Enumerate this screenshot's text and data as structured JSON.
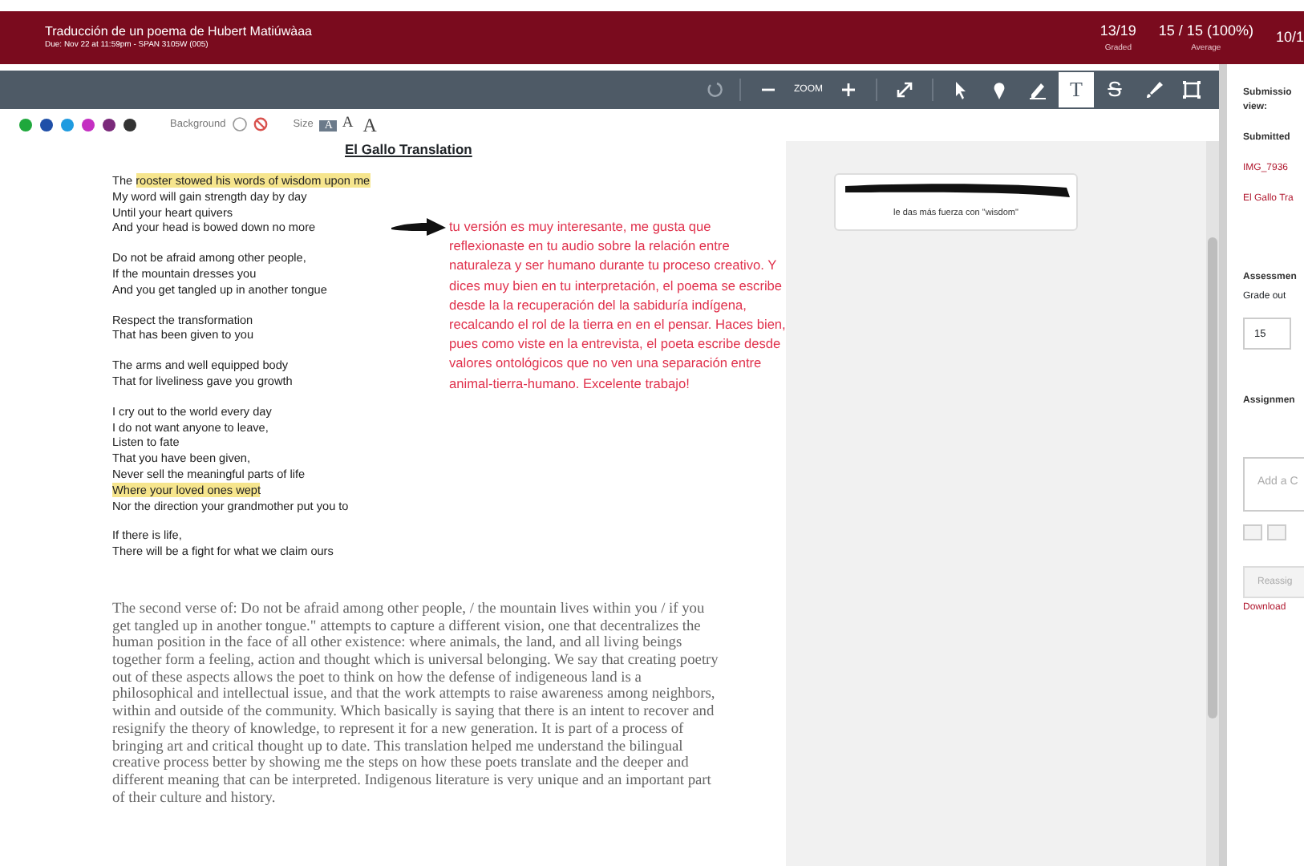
{
  "header": {
    "title": "Traducción de un poema de Hubert Matiúwàaa",
    "due": "Due: Nov 22 at 11:59pm - SPAN 3105W (005)",
    "stats": [
      {
        "value": "13/19",
        "label": "Graded"
      },
      {
        "value": "15 / 15 (100%)",
        "label": "Average"
      },
      {
        "value": "10/1"
      }
    ]
  },
  "toolbar": {
    "zoom_label": "ZOOM",
    "tools": [
      {
        "kind": "rotate",
        "selected": false
      },
      {
        "kind": "minus",
        "selected": false
      },
      {
        "kind": "plus",
        "selected": false
      },
      {
        "kind": "expand",
        "selected": false
      },
      {
        "kind": "pointer",
        "selected": false
      },
      {
        "kind": "pin",
        "selected": false
      },
      {
        "kind": "pencil",
        "selected": false
      },
      {
        "kind": "text",
        "selected": true
      },
      {
        "kind": "strike",
        "selected": false
      },
      {
        "kind": "brush",
        "selected": false
      },
      {
        "kind": "area",
        "selected": false
      }
    ],
    "text_glyph": "T",
    "strike_glyph": "S"
  },
  "options": {
    "colors": [
      {
        "color": "#1fa83c"
      },
      {
        "color": "#1f4fa8"
      },
      {
        "color": "#1f9be0"
      },
      {
        "color": "#c42fc2"
      },
      {
        "color": "#7a2a7a"
      },
      {
        "color": "#333333"
      }
    ],
    "background_label": "Background",
    "size_label": "Size",
    "sizes": [
      {
        "label": "A",
        "selected": true
      },
      {
        "label": "A",
        "selected": false
      },
      {
        "label": "A",
        "selected": false
      }
    ]
  },
  "document": {
    "title": "El Gallo Translation",
    "stanzas": [
      [
        [
          {
            "text": "The ",
            "highlight": false
          },
          {
            "text": "rooster stowed his words of wisdom upon me",
            "highlight": true
          }
        ],
        [
          {
            "text": "My word will gain strength day by day",
            "highlight": false
          }
        ],
        [
          {
            "text": "Until your heart quivers",
            "highlight": false
          }
        ],
        [
          {
            "text": "And your head is bowed down no more",
            "highlight": false
          }
        ]
      ],
      [
        [
          {
            "text": "Do not be afraid among other people,",
            "highlight": false
          }
        ],
        [
          {
            "text": "If the mountain dresses you",
            "highlight": false
          }
        ],
        [
          {
            "text": "And you get tangled up in another tongue",
            "highlight": false
          }
        ]
      ],
      [
        [
          {
            "text": "Respect the transformation",
            "highlight": false
          }
        ],
        [
          {
            "text": "That has been given to you",
            "highlight": false
          }
        ]
      ],
      [
        [
          {
            "text": "The arms and well equipped body",
            "highlight": false
          }
        ],
        [
          {
            "text": "That for liveliness gave you growth",
            "highlight": false
          }
        ]
      ],
      [
        [
          {
            "text": "I cry out to the world every day",
            "highlight": false
          }
        ],
        [
          {
            "text": "I do not want anyone to leave,",
            "highlight": false
          }
        ],
        [
          {
            "text": "Listen to fate",
            "highlight": false
          }
        ],
        [
          {
            "text": "That you have been given,",
            "highlight": false
          }
        ],
        [
          {
            "text": "Never sell the meaningful parts of life",
            "highlight": false
          }
        ],
        [
          {
            "text": "Where your loved ones wept",
            "highlight": true
          }
        ],
        [
          {
            "text": "Nor the direction your grandmother put you to",
            "highlight": false
          }
        ]
      ],
      [
        [
          {
            "text": "If there is life,",
            "highlight": false
          }
        ],
        [
          {
            "text": "There will be a fight for what we claim ours",
            "highlight": false
          }
        ]
      ]
    ],
    "essay": "The second verse of: Do not be afraid among other people, / the mountain lives within you / if you get tangled up in another tongue.\" attempts to capture a different vision, one that decentralizes the human position in the face of all other existence: where animals, the land, and all living beings together form a feeling, action and thought which is universal belonging. We say that creating poetry out of these aspects allows the poet to think on how the defense of indigeneous land is a philosophical and intellectual issue, and that the work attempts to raise awareness among neighbors, within and outside of the community. Which basically is saying that there is an intent to recover and resignify the theory of knowledge, to represent it for a new generation. It is part of a process of bringing art and critical thought up to date. This translation helped me understand the bilingual creative process better by showing me the steps on how these poets translate and the deeper and different meaning that can be interpreted. Indigenous literature is very unique and an important part of their culture and history.",
    "annotation": "tu versión es muy interesante, me gusta que reflexionaste en tu audio sobre la relación entre naturaleza y ser humano durante tu proceso creativo. Y dices muy bien en tu interpretación, el poema se escribe desde la la recuperación del la sabiduría indígena, recalcando el rol de la tierra en en el pensar. Haces bien, pues como viste en la entrevista, el poeta escribe desde valores ontológicos que no ven una separación entre animal-tierra-humano.  Excelente trabajo!"
  },
  "comment_card": {
    "text": "le das más fuerza con \"wisdom\""
  },
  "side_panel": {
    "heading": [
      "Submissio",
      "view:"
    ],
    "submitted_label": "Submitted",
    "files": [
      "IMG_7936",
      "El Gallo Tra"
    ],
    "assessment_label": "Assessmen",
    "grade_label": "Grade out",
    "grade_value": "15",
    "assignment_label": "Assignmen",
    "comment_placeholder": "Add a C",
    "reassign": "Reassig",
    "download": "Download"
  }
}
